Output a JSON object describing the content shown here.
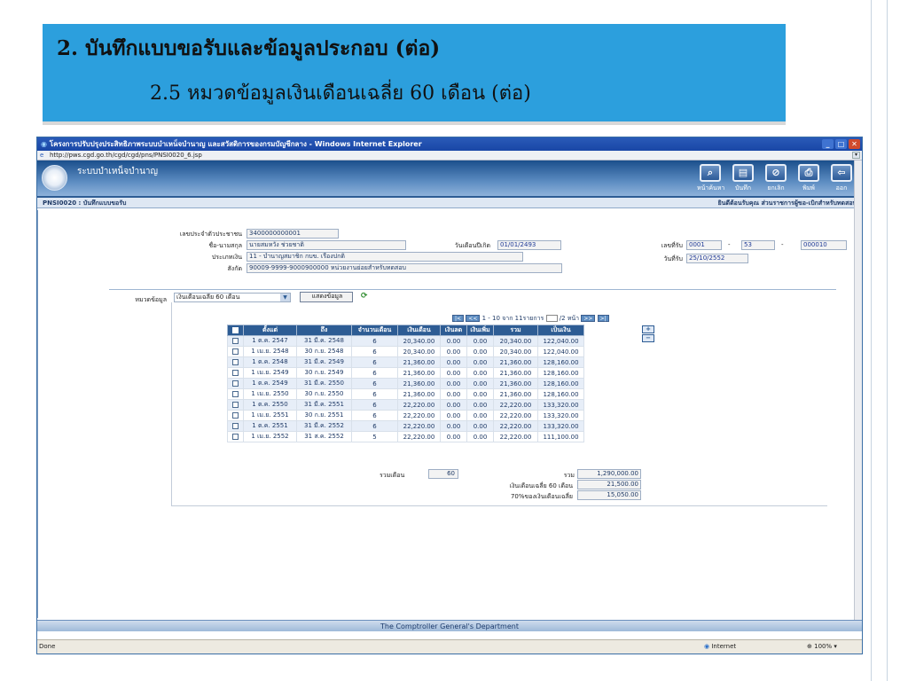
{
  "slide": {
    "title_line1": "2. บันทึกแบบขอรับและข้อมูลประกอบ (ต่อ)",
    "title_line2": "2.5 หมวดข้อมูลเงินเดือนเฉลี่ย 60 เดือน (ต่อ)"
  },
  "window": {
    "title": "โครงการปรับปรุงประสิทธิภาพระบบบำเหน็จบำนาญ และสวัสดิการของกรมบัญชีกลาง - Windows Internet Explorer",
    "address": "http://pws.cgd.go.th/cgd/cgd/pns/PNSI0020_6.jsp"
  },
  "app": {
    "name": "ระบบบำเหน็จบำนาญ",
    "toolbar": [
      {
        "label": "หน้าค้นหา",
        "icon": "search-icon"
      },
      {
        "label": "บันทึก",
        "icon": "save-icon"
      },
      {
        "label": "ยกเลิก",
        "icon": "cancel-icon"
      },
      {
        "label": "พิมพ์",
        "icon": "print-icon"
      },
      {
        "label": "ออก",
        "icon": "exit-icon"
      }
    ],
    "form_code": "PNSI0020 : บันทึกแบบขอรับ",
    "welcome": "ยินดีต้อนรับคุณ ส่วนราชการผู้ขอ-เบิกสำหรับทดสอบ"
  },
  "form": {
    "citizen_id_label": "เลขประจำตัวประชาชน",
    "citizen_id": "3400000000001",
    "name_label": "ชื่อ-นามสกุล",
    "name": "นายสมหวัง ช่วยชาติ",
    "birthdate_label": "วันเดือนปีเกิด",
    "birthdate": "01/01/2493",
    "pension_type_label": "ประเภทเงิน",
    "pension_type": "11 - บำนาญสมาชิก กบข. เรื่องปกติ",
    "affiliation_label": "สังกัด",
    "affiliation": "90009-9999-9000900000  หน่วยงานย่อยสำหรับทดสอบ",
    "receipt_no_label": "เลขที่รับ",
    "receipt_no_1": "0001",
    "receipt_no_2": "53",
    "receipt_no_3": "000010",
    "dash": "-",
    "receipt_date_label": "วันที่รับ",
    "receipt_date": "25/10/2552",
    "category_label": "หมวดข้อมูล",
    "category_value": "เงินเดือนเฉลี่ย 60 เดือน",
    "show_button": "แสดงข้อมูล"
  },
  "pager": {
    "text": "1 - 10 จาก 11รายการ",
    "page_suffix": "/2 หน้า",
    "first": "|<",
    "prev": "<<",
    "next": ">>",
    "last": ">|"
  },
  "table": {
    "headers": [
      "ตั้งแต่",
      "ถึง",
      "จำนวนเดือน",
      "เงินเดือน",
      "เงินลด",
      "เงินเพิ่ม",
      "รวม",
      "เป็นเงิน"
    ],
    "rows": [
      [
        "1 ต.ค. 2547",
        "31 มี.ค. 2548",
        "6",
        "20,340.00",
        "0.00",
        "0.00",
        "20,340.00",
        "122,040.00"
      ],
      [
        "1 เม.ย. 2548",
        "30 ก.ย. 2548",
        "6",
        "20,340.00",
        "0.00",
        "0.00",
        "20,340.00",
        "122,040.00"
      ],
      [
        "1 ต.ค. 2548",
        "31 มี.ค. 2549",
        "6",
        "21,360.00",
        "0.00",
        "0.00",
        "21,360.00",
        "128,160.00"
      ],
      [
        "1 เม.ย. 2549",
        "30 ก.ย. 2549",
        "6",
        "21,360.00",
        "0.00",
        "0.00",
        "21,360.00",
        "128,160.00"
      ],
      [
        "1 ต.ค. 2549",
        "31 มี.ค. 2550",
        "6",
        "21,360.00",
        "0.00",
        "0.00",
        "21,360.00",
        "128,160.00"
      ],
      [
        "1 เม.ย. 2550",
        "30 ก.ย. 2550",
        "6",
        "21,360.00",
        "0.00",
        "0.00",
        "21,360.00",
        "128,160.00"
      ],
      [
        "1 ต.ค. 2550",
        "31 มี.ค. 2551",
        "6",
        "22,220.00",
        "0.00",
        "0.00",
        "22,220.00",
        "133,320.00"
      ],
      [
        "1 เม.ย. 2551",
        "30 ก.ย. 2551",
        "6",
        "22,220.00",
        "0.00",
        "0.00",
        "22,220.00",
        "133,320.00"
      ],
      [
        "1 ต.ค. 2551",
        "31 มี.ค. 2552",
        "6",
        "22,220.00",
        "0.00",
        "0.00",
        "22,220.00",
        "133,320.00"
      ],
      [
        "1 เม.ย. 2552",
        "31 ส.ค. 2552",
        "5",
        "22,220.00",
        "0.00",
        "0.00",
        "22,220.00",
        "111,100.00"
      ]
    ]
  },
  "summary": {
    "total_months_label": "รวมเดือน",
    "total_months": "60",
    "total_label": "รวม",
    "total": "1,290,000.00",
    "avg_label": "เงินเดือนเฉลี่ย 60 เดือน",
    "avg": "21,500.00",
    "pct_label": "70%ของเงินเดือนเฉลี่ย",
    "pct": "15,050.00"
  },
  "footer": {
    "department": "The Comptroller General's Department",
    "status": "Done",
    "zone": "Internet",
    "zoom": "100%"
  }
}
